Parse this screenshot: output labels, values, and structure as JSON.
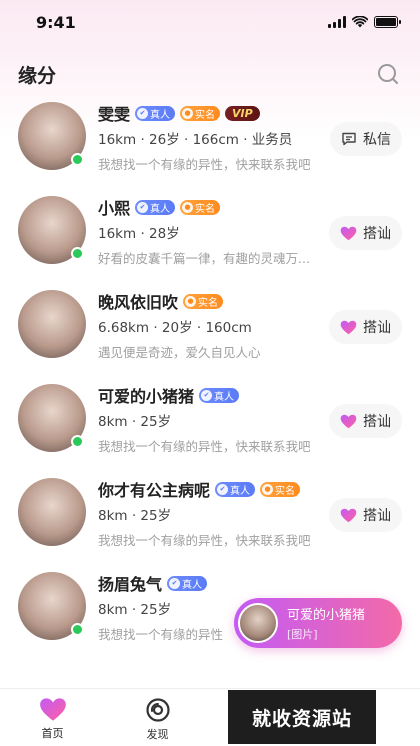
{
  "status": {
    "time": "9:41"
  },
  "header": {
    "title": "缘分"
  },
  "badges": {
    "real": "真人",
    "realname": "实名",
    "vip": "VIP"
  },
  "users": [
    {
      "name": "雯雯",
      "meta": "16km · 26岁 · 166cm · 业务员",
      "bio": "我想找一个有缘的异性，快来联系我吧",
      "action": "私信"
    },
    {
      "name": "小熙",
      "meta": "16km · 28岁",
      "bio": "好看的皮囊千篇一律，有趣的灵魂万...",
      "action": "搭讪"
    },
    {
      "name": "晚风依旧吹",
      "meta": "6.68km · 20岁 · 160cm",
      "bio": "遇见便是奇迹，爱久自见人心",
      "action": "搭讪"
    },
    {
      "name": "可爱的小猪猪",
      "meta": "8km · 25岁",
      "bio": "我想找一个有缘的异性，快来联系我吧",
      "action": "搭讪"
    },
    {
      "name": "你才有公主病呢",
      "meta": "8km · 25岁",
      "bio": "我想找一个有缘的异性，快来联系我吧",
      "action": "搭讪"
    },
    {
      "name": "扬眉兔气",
      "meta": "8km · 25岁",
      "bio": "我想找一个有缘的异性"
    }
  ],
  "toast": {
    "name": "可爱的小猪猪",
    "sub": "[图片]"
  },
  "tabs": [
    {
      "label": "首页"
    },
    {
      "label": "发现"
    }
  ],
  "watermark": "就收资源站",
  "colors": {
    "accent": "#f36aa8",
    "online": "#2bc85a"
  }
}
